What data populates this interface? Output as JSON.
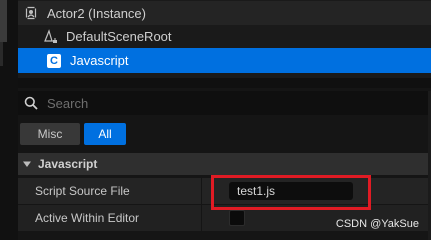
{
  "tree": {
    "actor_label": "Actor2 (Instance)",
    "actor_icon": "actor-icon",
    "items": [
      {
        "label": "DefaultSceneRoot",
        "icon": "scene-component-icon"
      },
      {
        "label": "Javascript",
        "icon": "script-component-icon",
        "icon_glyph": "C",
        "selected": true
      }
    ]
  },
  "search": {
    "placeholder": "Search",
    "icon": "search-icon"
  },
  "categories": [
    {
      "label": "Misc",
      "active": false
    },
    {
      "label": "All",
      "active": true
    }
  ],
  "details": {
    "section_title": "Javascript",
    "properties": [
      {
        "label": "Script Source File",
        "value": "test1.js"
      },
      {
        "label": "Active Within Editor",
        "value": false
      }
    ]
  },
  "watermark": "CSDN @YakSue",
  "colors": {
    "accent": "#0070e0",
    "highlight": "#e01b24",
    "panel": "#242424",
    "background": "#151515"
  }
}
